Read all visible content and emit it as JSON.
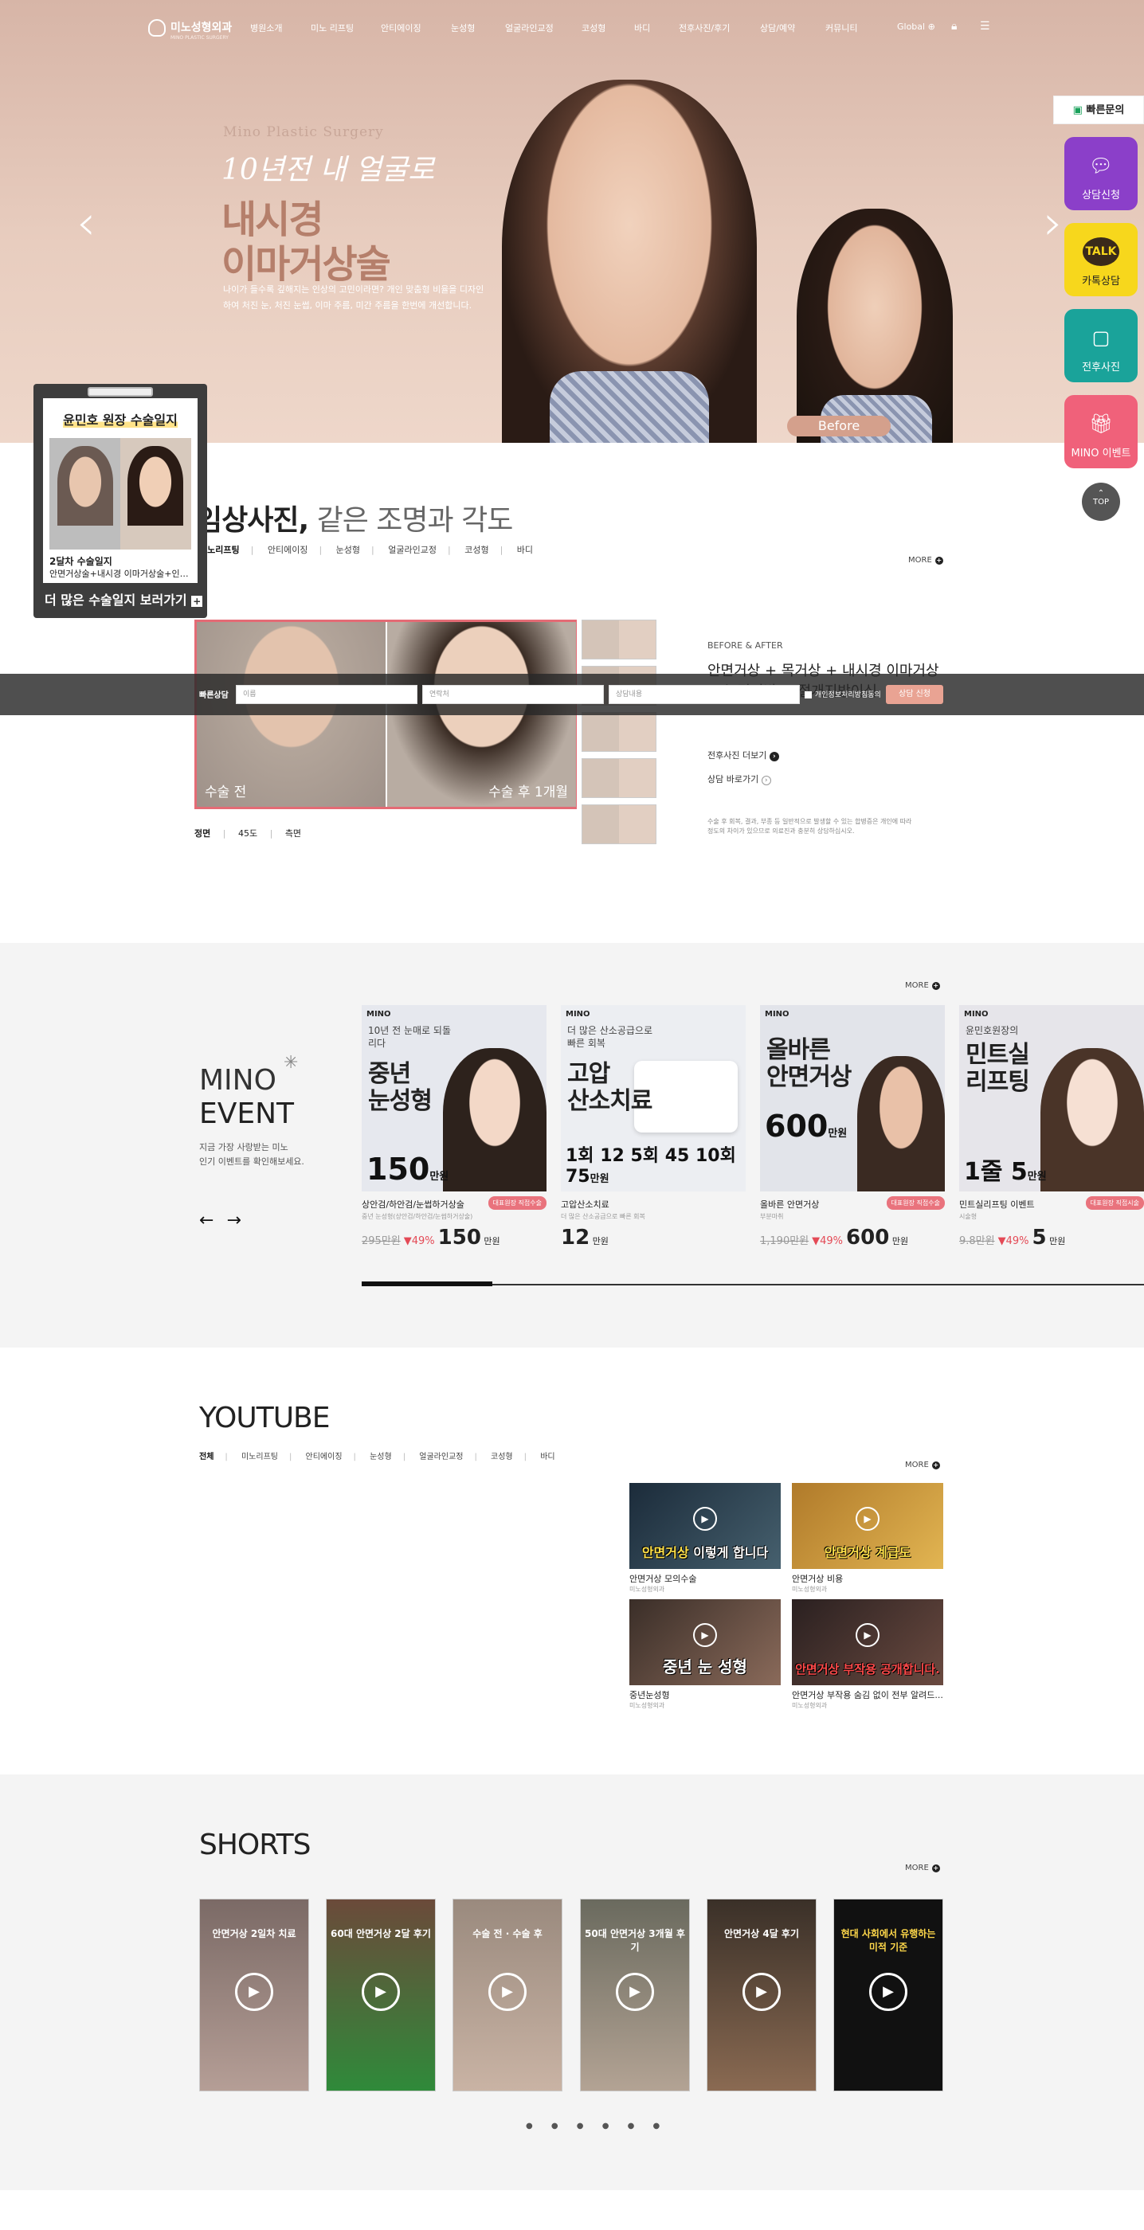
{
  "header": {
    "logo": "미노성형외과",
    "logo_sub": "MINO PLASTIC SURGERY",
    "nav": [
      "병원소개",
      "미노 리프팅",
      "안티에이징",
      "눈성형",
      "얼굴라인교정",
      "코성형",
      "바디",
      "전후사진/후기",
      "상담/예약",
      "커뮤니티"
    ],
    "global": "Global"
  },
  "hero": {
    "subtitle": "Mino Plastic Surgery",
    "script": "10년전 내 얼굴로",
    "title1": "내시경",
    "title2": "이마거상술",
    "desc": "나이가 들수록 깊해지는 인상의 고민이라면? 개인 맞춤형 비율을 디자인하여 처진 눈, 처진 눈썹, 이마 주름, 미간 주름을 한번에 개선합니다.",
    "before_label": "Before",
    "prev": "‹",
    "next": "›"
  },
  "quick_menu": {
    "title": "빠른문의",
    "items": [
      {
        "label": "상담신청",
        "color": "#8b3fc9",
        "icon": "chat-icon"
      },
      {
        "label": "카톡상담",
        "color": "#f7d71c",
        "icon": "kakao-icon"
      },
      {
        "label": "전후사진",
        "color": "#1aa39a",
        "icon": "photo-icon"
      },
      {
        "label": "MINO 이벤트",
        "color": "#f0617a",
        "icon": "gift-icon"
      }
    ],
    "top": "TOP"
  },
  "popup": {
    "title_pre": "윤민호 원장 ",
    "title_hl": "수술일지",
    "cap1": "2달차 수술일지",
    "cap2": "안면거상술+내시경 이마거상술+인디...",
    "more": "더 많은 수술일지 보러가기"
  },
  "clinical": {
    "title_strong": "임상사진,",
    "title_light": " 같은 조명과 각도",
    "tabs": [
      "미노리프팅",
      "안티에이징",
      "눈성형",
      "얼굴라인교정",
      "코성형",
      "바디"
    ],
    "more": "MORE",
    "before_cap": "수술 전",
    "after_cap": "수술 후 1개월",
    "views": [
      "정면",
      "45도",
      "측면"
    ],
    "label": "BEFORE & AFTER",
    "desc_title": "안면거상 + 목거상 + 내시경 이마거상 + 눈밑지방 + 절개지방이식",
    "link1": "전후사진 더보기",
    "link2": "상담 바로가기",
    "note": "수술 후 회복, 결과, 부종 등 일반적으로 발생할 수 있는 합병증은 개인에 따라 정도의 차이가 있으므로 의료진과 충분히 상담하십시오."
  },
  "consult": {
    "label": "빠른상담",
    "name_ph": "이름",
    "phone_ph": "연락처",
    "content_ph": "상담내용",
    "agree": "개인정보처리방침동의",
    "submit": "상담 신청"
  },
  "event": {
    "title1": "MINO",
    "title2": "EVENT",
    "desc1": "지금 가장 사랑받는 미노",
    "desc2": "인기 이벤트를 확인해보세요.",
    "more": "MORE",
    "prev": "←",
    "next": "→",
    "cards": [
      {
        "logo": "MINO",
        "pre": "10년 전 눈매로 되돌리다",
        "head": "중년\n눈성형",
        "bigprice": "150",
        "unit": "만원",
        "name": "상안검/하안검/눈썹하거상술",
        "sub": "중년 눈성형(상안검/하안검/눈썹하거상술)",
        "badge": "대표원장 직접수술",
        "old": "295만원",
        "pct": "▼49%",
        "price": "150",
        "price_unit": "만원",
        "bg": "#e6e8ee"
      },
      {
        "logo": "MINO",
        "pre": "더 많은 산소공급으로 빠른 회복",
        "head": "고압\n산소치료",
        "bigprice": "1회 12 5회 45 10회 75",
        "unit": "만원",
        "name": "고압산소치료",
        "sub": "더 많은 산소공급으로 빠른 회복",
        "badge": "",
        "old": "",
        "pct": "",
        "price": "12",
        "price_unit": "만원",
        "bg": "#eceef2"
      },
      {
        "logo": "MINO",
        "pre": "",
        "head": "올바른\n안면거상",
        "bigprice": "600",
        "unit": "만원",
        "name": "올바른 안면거상",
        "sub": "부분마취",
        "badge": "대표원장 직접수술",
        "old": "1,190만원",
        "pct": "▼49%",
        "price": "600",
        "price_unit": "만원",
        "bg": "#e2e4ea"
      },
      {
        "logo": "MINO",
        "pre": "윤민호원장의",
        "head": "민트실\n리프팅",
        "bigprice": "1줄 5",
        "unit": "만원",
        "name": "민트실리프팅 이벤트",
        "sub": "시술형",
        "badge": "대표원장 직접시술",
        "old": "9.8만원",
        "pct": "▼49%",
        "price": "5",
        "price_unit": "만원",
        "bg": "#e6e5ea"
      }
    ]
  },
  "youtube": {
    "title": "YOUTUBE",
    "tabs": [
      "전체",
      "미노리프팅",
      "안티에이징",
      "눈성형",
      "얼굴라인교정",
      "코성형",
      "바디"
    ],
    "more": "MORE",
    "videos": [
      {
        "overlay_pre": "안면거상 ",
        "overlay_hl": "",
        "overlay": "이렇게 합니다",
        "title": "안면거상 모의수술",
        "sub": "미노성형외과",
        "bg": "#1b2b3a"
      },
      {
        "overlay_pre": "",
        "overlay_hl": "",
        "overlay": "안면거상 계급도",
        "title": "안면거상 비용",
        "sub": "미노성형외과",
        "bg": "#b07a2a"
      },
      {
        "overlay_pre": "",
        "overlay_hl": "",
        "overlay": "중년 눈 성형",
        "title": "중년눈성형",
        "sub": "미노성형외과",
        "bg": "#4b3a2e"
      },
      {
        "overlay_pre": "",
        "overlay_hl": "",
        "overlay": "안면거상 부작용 공개합니다.",
        "title": "안면거상 부작용 숨김 없이 전부 알려드...",
        "sub": "미노성형외과",
        "bg": "#3a2a2a"
      }
    ]
  },
  "shorts": {
    "title": "SHORTS",
    "more": "MORE",
    "items": [
      {
        "text": "안면거상 2일차 치료",
        "bg": "#7b6a66"
      },
      {
        "text": "60대 안면거상 2달 후기",
        "bg": "#6b4a3a"
      },
      {
        "text": "수술 전 · 수술 후",
        "bg": "#9a8a7e"
      },
      {
        "text": "50대 안면거상 3개월 후기",
        "bg": "#6a6a5e"
      },
      {
        "text": "안면거상 4달 후기",
        "bg": "#3a3028"
      },
      {
        "text": "현대 사회에서 유행하는 미적 기준",
        "bg": "#111"
      }
    ],
    "pages": "● ● ● ● ● ●"
  }
}
